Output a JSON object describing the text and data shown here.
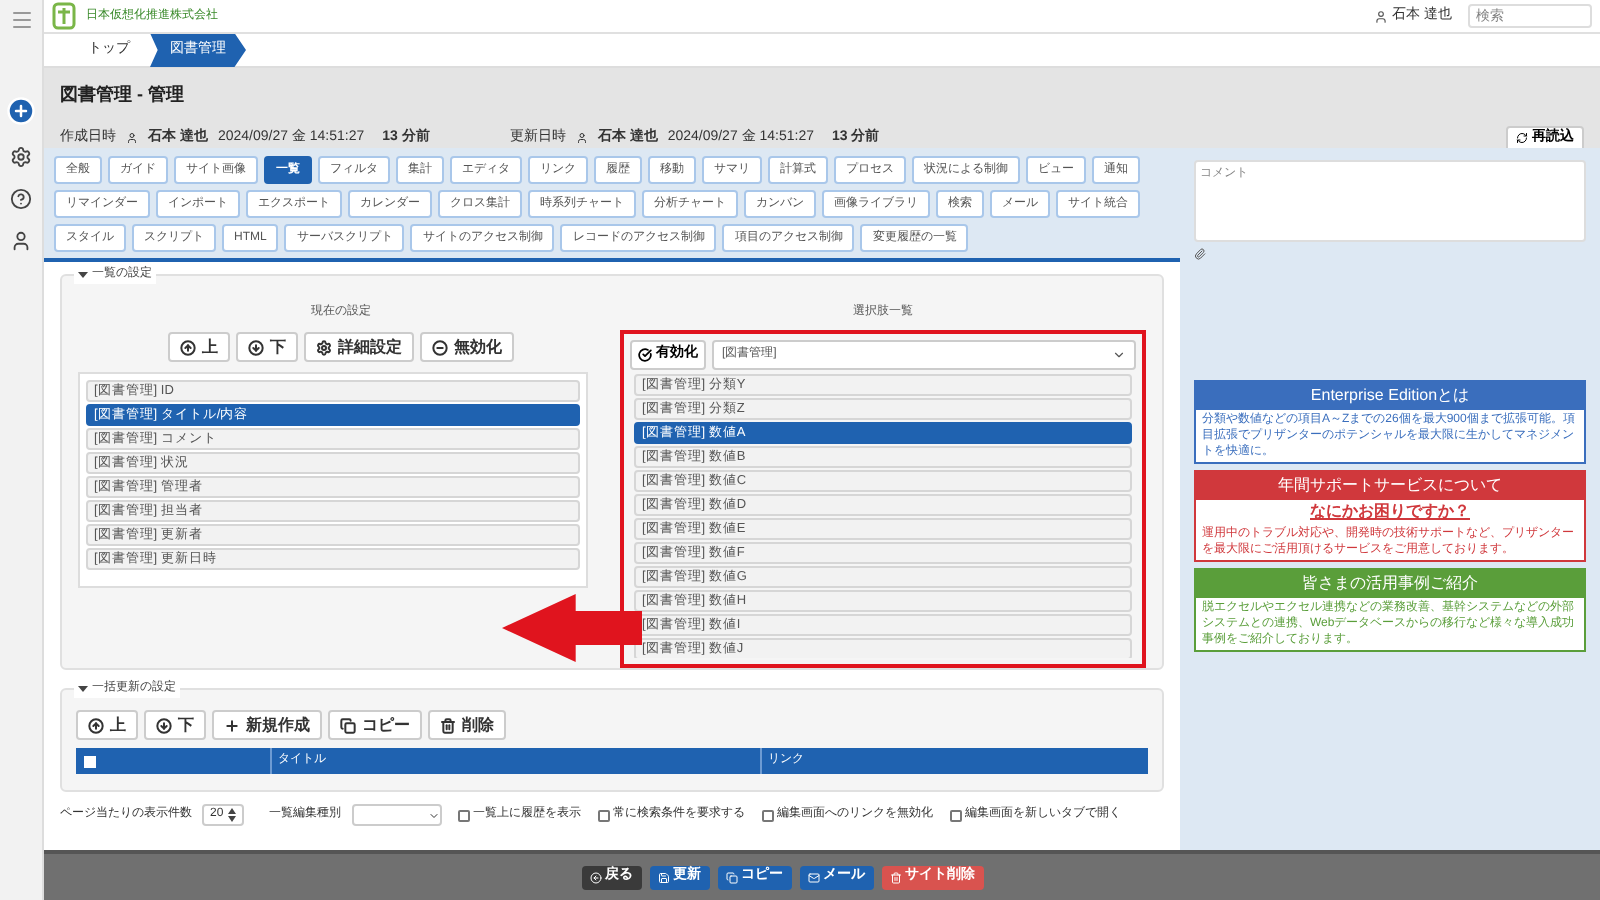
{
  "header": {
    "company": "日本仮想化推進株式会社",
    "user": "石本 達也",
    "search": {
      "placeholder": "検索"
    }
  },
  "breadcrumb": [
    {
      "label": "トップ",
      "selected": false
    },
    {
      "label": "図書管理",
      "selected": true
    }
  ],
  "title": "図書管理 - 管理",
  "meta": [
    {
      "label": "作成日時",
      "user": "石本 達也",
      "datetime": "2024/09/27 金 14:51:27",
      "ago": "13 分前"
    },
    {
      "label": "更新日時",
      "user": "石本 達也",
      "datetime": "2024/09/27 金 14:51:27",
      "ago": "13 分前"
    }
  ],
  "reload_button": "再読込",
  "tabs": [
    {
      "label": "全般",
      "selected": false
    },
    {
      "label": "ガイド",
      "selected": false
    },
    {
      "label": "サイト画像",
      "selected": false
    },
    {
      "label": "一覧",
      "selected": true
    },
    {
      "label": "フィルタ",
      "selected": false
    },
    {
      "label": "集計",
      "selected": false
    },
    {
      "label": "エディタ",
      "selected": false
    },
    {
      "label": "リンク",
      "selected": false
    },
    {
      "label": "履歴",
      "selected": false
    },
    {
      "label": "移動",
      "selected": false
    },
    {
      "label": "サマリ",
      "selected": false
    },
    {
      "label": "計算式",
      "selected": false
    },
    {
      "label": "プロセス",
      "selected": false
    },
    {
      "label": "状況による制御",
      "selected": false
    },
    {
      "label": "ビュー",
      "selected": false
    },
    {
      "label": "通知",
      "selected": false
    },
    {
      "label": "リマインダー",
      "selected": false
    },
    {
      "label": "インポート",
      "selected": false
    },
    {
      "label": "エクスポート",
      "selected": false
    },
    {
      "label": "カレンダー",
      "selected": false
    },
    {
      "label": "クロス集計",
      "selected": false
    },
    {
      "label": "時系列チャート",
      "selected": false
    },
    {
      "label": "分析チャート",
      "selected": false
    },
    {
      "label": "カンバン",
      "selected": false
    },
    {
      "label": "画像ライブラリ",
      "selected": false
    },
    {
      "label": "検索",
      "selected": false
    },
    {
      "label": "メール",
      "selected": false
    },
    {
      "label": "サイト統合",
      "selected": false
    },
    {
      "label": "スタイル",
      "selected": false
    },
    {
      "label": "スクリプト",
      "selected": false
    },
    {
      "label": "HTML",
      "selected": false
    },
    {
      "label": "サーバスクリプト",
      "selected": false
    },
    {
      "label": "サイトのアクセス制御",
      "selected": false
    },
    {
      "label": "レコードのアクセス制御",
      "selected": false
    },
    {
      "label": "項目のアクセス制御",
      "selected": false
    },
    {
      "label": "変更履歴の一覧",
      "selected": false
    }
  ],
  "comment": {
    "placeholder": "コメント"
  },
  "list_settings": {
    "legend": "一覧の設定",
    "expanded": true,
    "current": {
      "heading": "現在の設定",
      "buttons": [
        {
          "label": "上",
          "kind": "up"
        },
        {
          "label": "下",
          "kind": "down"
        },
        {
          "label": "詳細設定",
          "kind": "settings"
        },
        {
          "label": "無効化",
          "kind": "disable"
        }
      ],
      "items": [
        {
          "label": "[図書管理] ID",
          "selected": false
        },
        {
          "label": "[図書管理] タイトル/内容",
          "selected": true
        },
        {
          "label": "[図書管理] コメント",
          "selected": false
        },
        {
          "label": "[図書管理] 状況",
          "selected": false
        },
        {
          "label": "[図書管理] 管理者",
          "selected": false
        },
        {
          "label": "[図書管理] 担当者",
          "selected": false
        },
        {
          "label": "[図書管理] 更新者",
          "selected": false
        },
        {
          "label": "[図書管理] 更新日時",
          "selected": false
        }
      ]
    },
    "choices": {
      "heading": "選択肢一覧",
      "enable_button": "有効化",
      "filter": "[図書管理]",
      "items": [
        {
          "label": "[図書管理] 分類Y",
          "selected": false
        },
        {
          "label": "[図書管理] 分類Z",
          "selected": false
        },
        {
          "label": "[図書管理] 数値A",
          "selected": true
        },
        {
          "label": "[図書管理] 数値B",
          "selected": false
        },
        {
          "label": "[図書管理] 数値C",
          "selected": false
        },
        {
          "label": "[図書管理] 数値D",
          "selected": false
        },
        {
          "label": "[図書管理] 数値E",
          "selected": false
        },
        {
          "label": "[図書管理] 数値F",
          "selected": false
        },
        {
          "label": "[図書管理] 数値G",
          "selected": false
        },
        {
          "label": "[図書管理] 数値H",
          "selected": false
        },
        {
          "label": "[図書管理] 数値I",
          "selected": false
        },
        {
          "label": "[図書管理] 数値J",
          "selected": false
        }
      ]
    }
  },
  "bulk": {
    "legend": "一括更新の設定",
    "expanded": true,
    "select_all_checked": false,
    "buttons": [
      {
        "label": "上",
        "kind": "up"
      },
      {
        "label": "下",
        "kind": "down"
      },
      {
        "label": "新規作成",
        "kind": "new"
      },
      {
        "label": "コピー",
        "kind": "copy"
      },
      {
        "label": "削除",
        "kind": "delete"
      }
    ],
    "columns": [
      "タイトル",
      "リンク"
    ]
  },
  "options": {
    "page_size_label": "ページ当たりの表示件数",
    "page_size": "20",
    "edit_type_label": "一覧編集種別",
    "checkboxes": [
      {
        "label": "一覧上に履歴を表示",
        "checked": false
      },
      {
        "label": "常に検索条件を要求する",
        "checked": false
      },
      {
        "label": "編集画面へのリンクを無効化",
        "checked": false
      },
      {
        "label": "編集画面を新しいタブで開く",
        "checked": false
      }
    ]
  },
  "footer_buttons": [
    {
      "label": "戻る",
      "kind": "back"
    },
    {
      "label": "更新",
      "kind": "update"
    },
    {
      "label": "コピー",
      "kind": "copy"
    },
    {
      "label": "メール",
      "kind": "mail"
    },
    {
      "label": "サイト削除",
      "kind": "delete"
    }
  ],
  "promos": [
    {
      "title": "Enterprise Editionとは",
      "body": "分類や数値などの項目A～Zまでの26個を最大900個まで拡張可能。項目拡張でプリザンターのポテンシャルを最大限に生かしてマネジメントを快適に。",
      "color": "#3a6ebd"
    },
    {
      "title": "年間サポートサービスについて",
      "subtitle": "なにかお困りですか？",
      "body": "運用中のトラブル対応や、開発時の技術サポートなど、プリザンターを最大限にご活用頂けるサービスをご用意しております。",
      "color": "#d0383c"
    },
    {
      "title": "皆さまの活用事例ご紹介",
      "body": "脱エクセルやエクセル連携などの業務改善、基幹システムなどの外部システムとの連携、Webデータベースからの移行など様々な導入成功事例をご紹介しております。",
      "color": "#5a9e3a"
    }
  ]
}
